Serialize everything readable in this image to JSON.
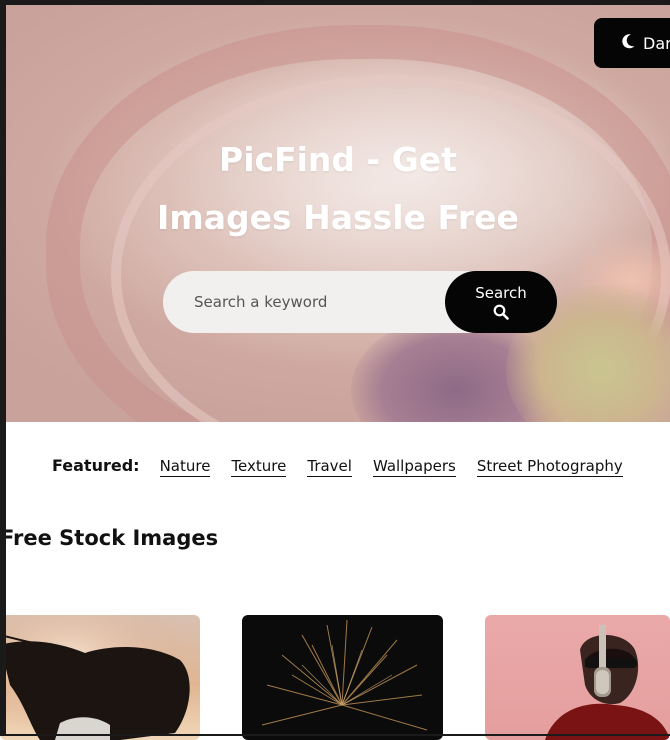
{
  "hero": {
    "mode_button": "Dark",
    "title_line1": "PicFind - Get",
    "title_line2": "Images Hassle Free",
    "search_placeholder": "Search a keyword",
    "search_button": "Search"
  },
  "featured": {
    "label": "Featured:",
    "links": [
      "Nature",
      "Texture",
      "Travel",
      "Wallpapers",
      "Street Photography"
    ]
  },
  "gallery": {
    "title": "Free Stock Images",
    "images": [
      {
        "subject": "woman-hair-sunset"
      },
      {
        "subject": "fireworks"
      },
      {
        "subject": "man-microphone-pink"
      }
    ]
  },
  "colors": {
    "button_bg": "#050505",
    "hero_tint": "#dcbfb7",
    "text": "#111111"
  }
}
